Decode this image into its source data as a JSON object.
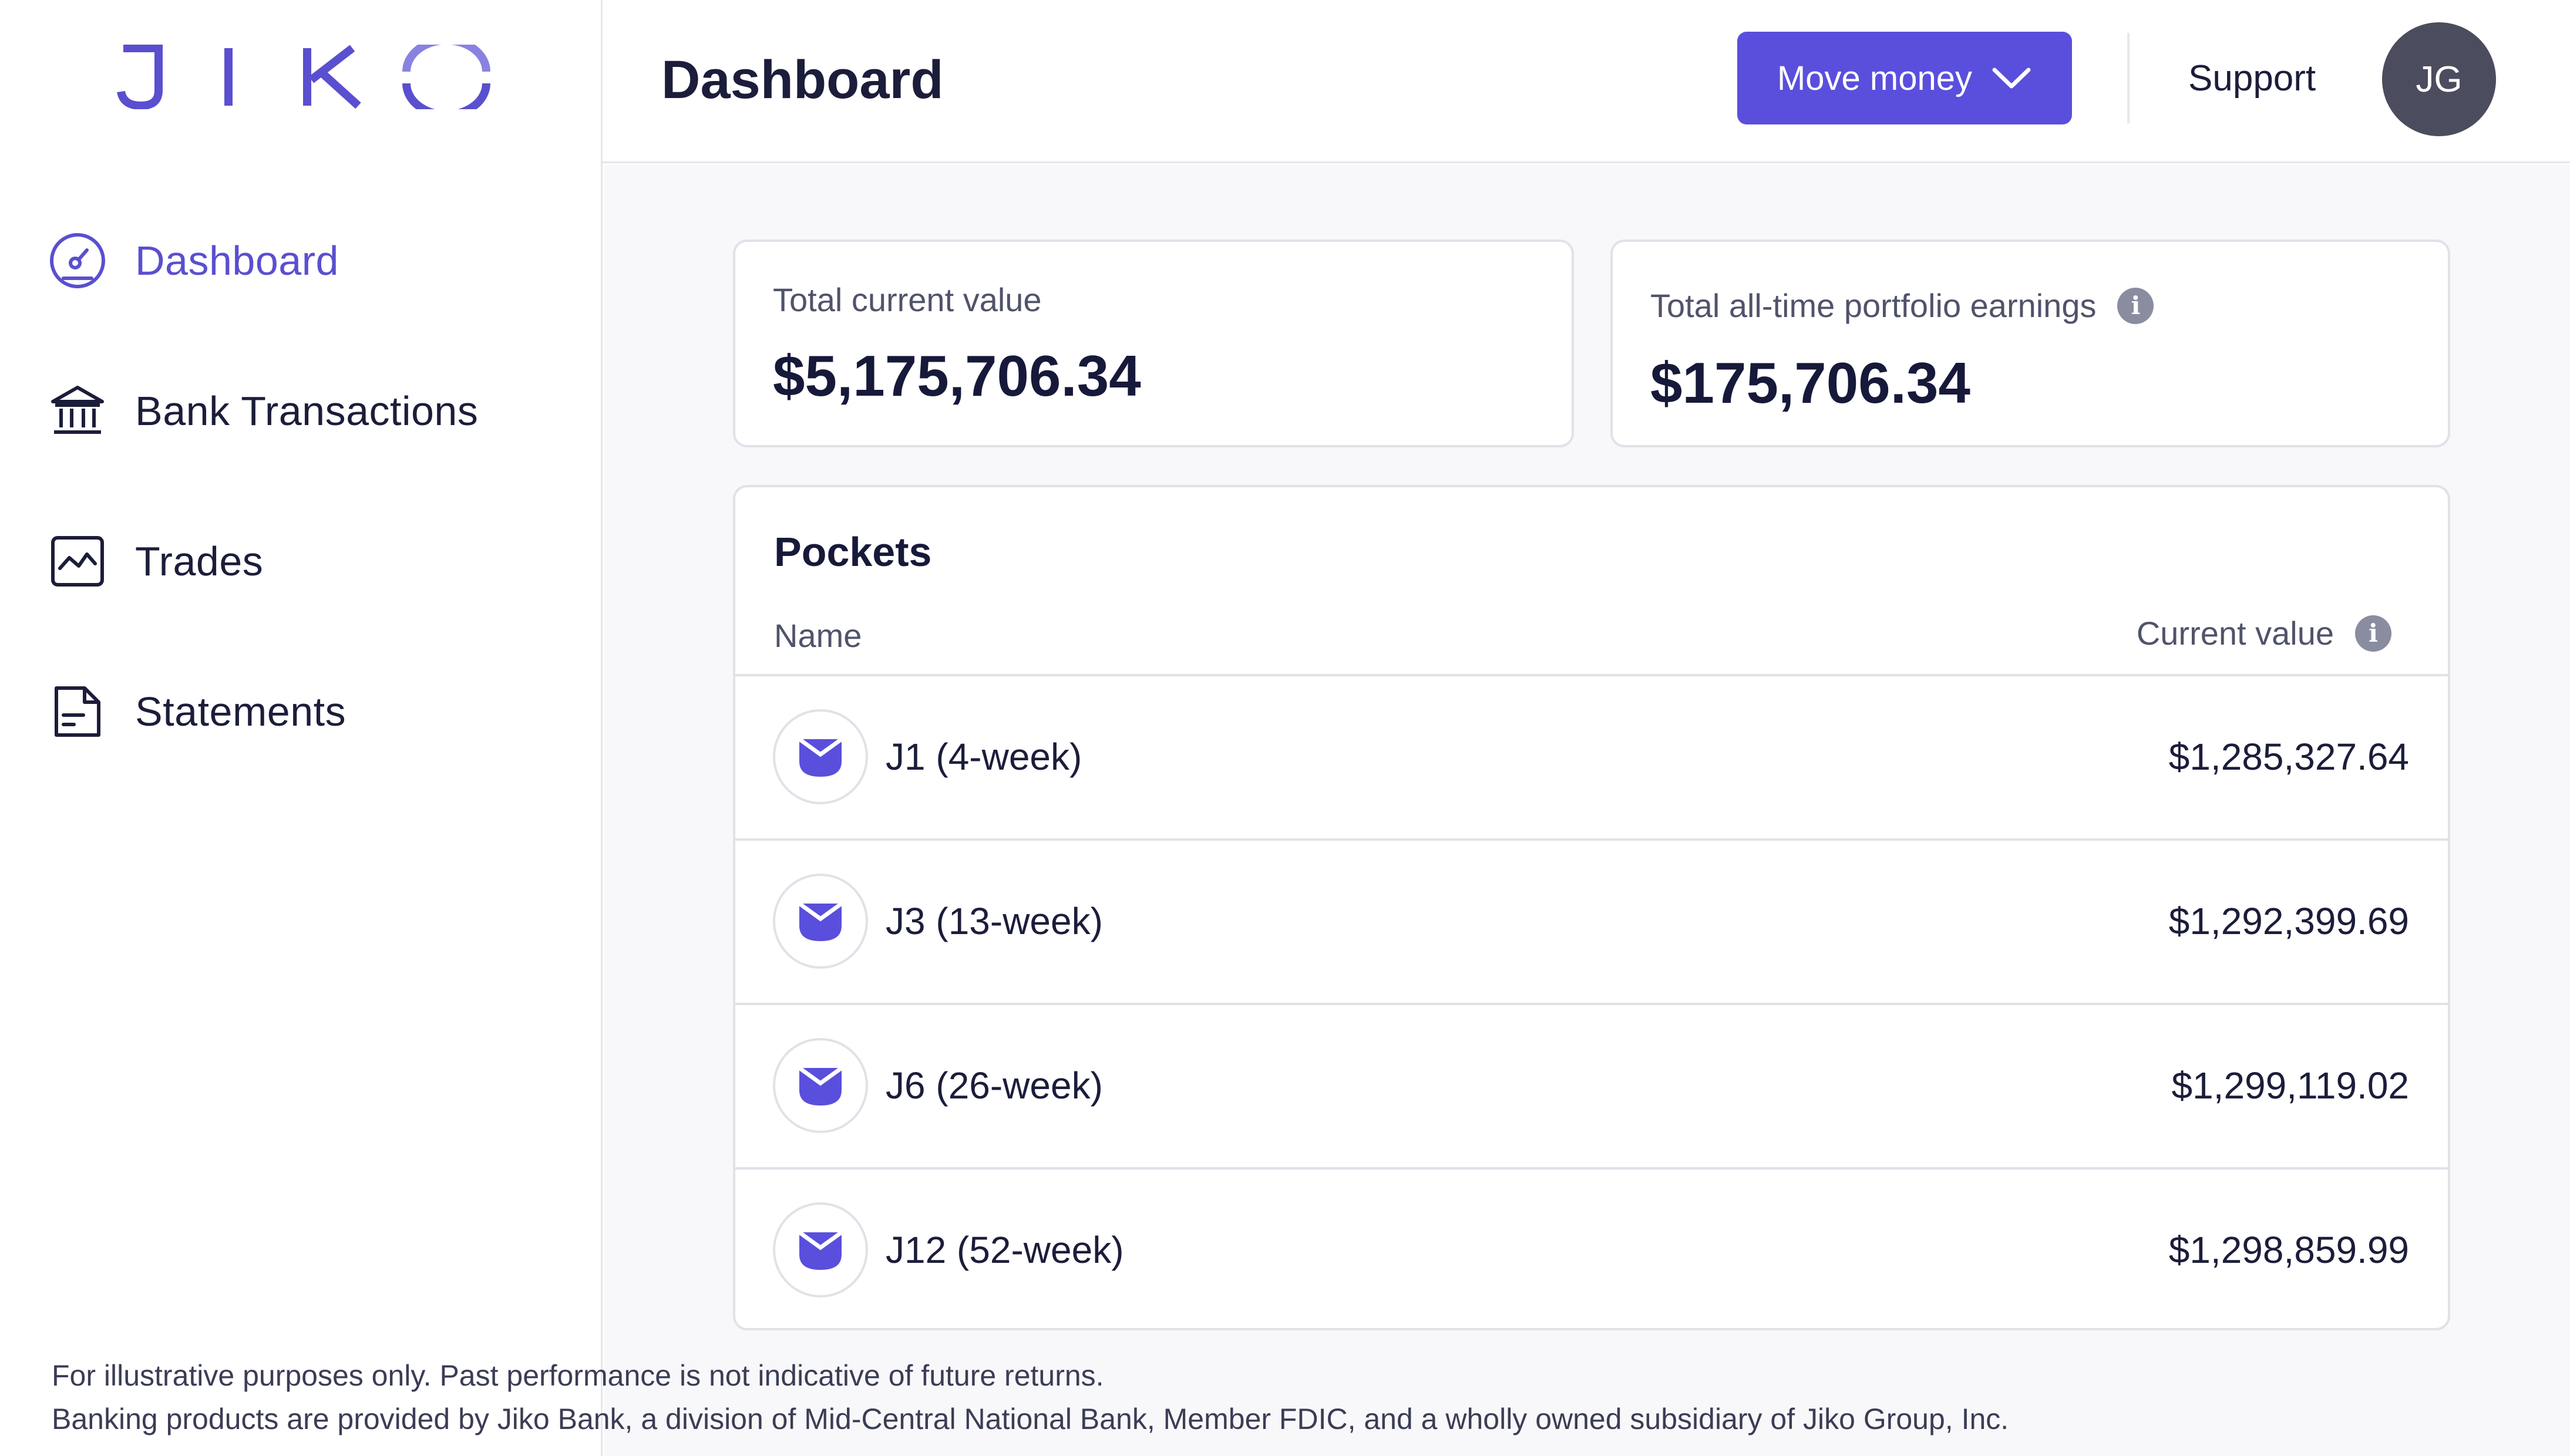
{
  "brand": {
    "logo_text": "JIKO",
    "accent": "#5a4fdc"
  },
  "sidebar": {
    "items": [
      {
        "label": "Dashboard",
        "icon": "speedometer-icon",
        "active": true
      },
      {
        "label": "Bank Transactions",
        "icon": "bank-icon",
        "active": false
      },
      {
        "label": "Trades",
        "icon": "line-chart-icon",
        "active": false
      },
      {
        "label": "Statements",
        "icon": "document-icon",
        "active": false
      }
    ]
  },
  "header": {
    "title": "Dashboard",
    "move_money_label": "Move money",
    "support_label": "Support",
    "avatar_initials": "JG"
  },
  "summary": {
    "total_current_value_label": "Total current value",
    "total_current_value": "$5,175,706.34",
    "total_earnings_label": "Total all-time portfolio earnings",
    "total_earnings": "$175,706.34",
    "info_glyph": "i"
  },
  "pockets": {
    "title": "Pockets",
    "col_name": "Name",
    "col_value": "Current value",
    "rows": [
      {
        "name": "J1 (4-week)",
        "value": "$1,285,327.64"
      },
      {
        "name": "J3 (13-week)",
        "value": "$1,292,399.69"
      },
      {
        "name": "J6 (26-week)",
        "value": "$1,299,119.02"
      },
      {
        "name": "J12 (52-week)",
        "value": "$1,298,859.99"
      }
    ]
  },
  "footer": {
    "line1": "For illustrative purposes only. Past performance is not indicative of future returns.",
    "line2": "Banking products are provided by Jiko Bank, a division of Mid-Central National Bank, Member FDIC, and a wholly owned subsidiary of Jiko Group, Inc."
  }
}
